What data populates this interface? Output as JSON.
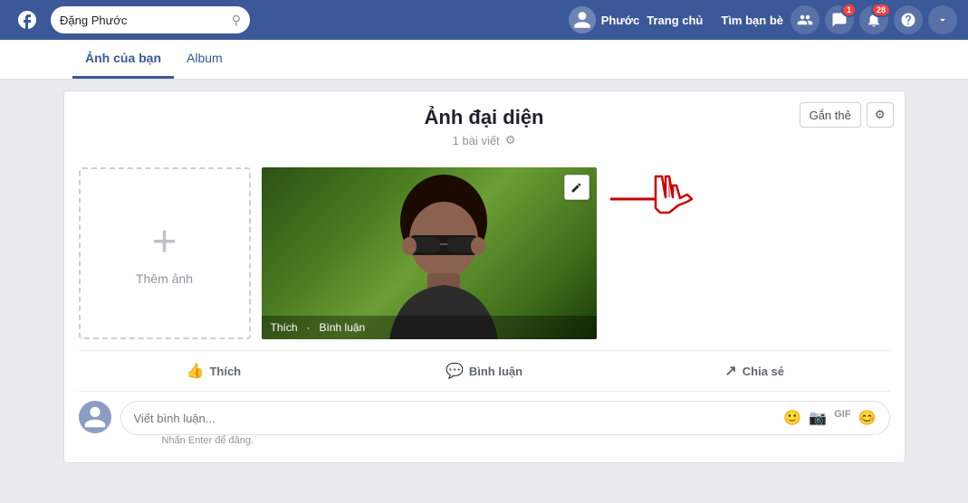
{
  "nav": {
    "search_placeholder": "Đặng Phước",
    "logo": "f",
    "user_name": "Phước",
    "links": [
      "Trang chủ",
      "Tìm bạn bè"
    ],
    "notification_count": "1",
    "message_count": "28"
  },
  "sub_nav": {
    "items": [
      "Ảnh của bạn",
      "Album"
    ],
    "active": 0
  },
  "card": {
    "title": "Ảnh đại diện",
    "meta": "1 bài viết",
    "tag_button": "Gắn thẻ",
    "settings_button": "⚙",
    "add_photo_label": "Thêm ảnh",
    "photo_overlay": {
      "like": "Thích",
      "comment": "Bình luận"
    }
  },
  "actions": {
    "like": "Thích",
    "comment": "Bình luận",
    "share": "Chia sẻ"
  },
  "comment": {
    "placeholder": "Viết bình luận...",
    "hint_text": "Nhấn Enter để đăng."
  },
  "annotation": {
    "label": "Gắn thẻ"
  }
}
